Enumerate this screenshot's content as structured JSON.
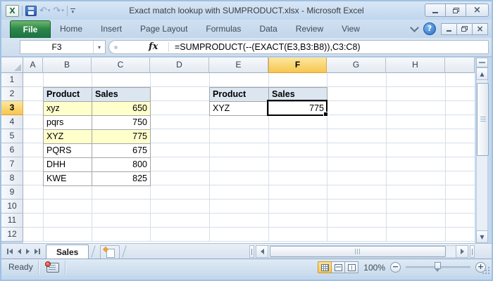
{
  "window": {
    "title": "Exact match lookup with SUMPRODUCT.xlsx - Microsoft Excel"
  },
  "ribbon": {
    "tabs": [
      "File",
      "Home",
      "Insert",
      "Page Layout",
      "Formulas",
      "Data",
      "Review",
      "View"
    ]
  },
  "formula_bar": {
    "name_box": "F3",
    "fx_label": "fx",
    "formula": "=SUMPRODUCT(--(EXACT(E3,B3:B8)),C3:C8)"
  },
  "grid": {
    "columns": [
      "A",
      "B",
      "C",
      "D",
      "E",
      "F",
      "G",
      "H"
    ],
    "rows": [
      "1",
      "2",
      "3",
      "4",
      "5",
      "6",
      "7",
      "8",
      "9",
      "10",
      "11",
      "12"
    ],
    "selected_cell": "F3",
    "selected_column": "F",
    "selected_row": "3"
  },
  "tables": {
    "left": {
      "headers": [
        "Product",
        "Sales"
      ],
      "rows": [
        [
          "xyz",
          "650"
        ],
        [
          "pqrs",
          "750"
        ],
        [
          "XYZ",
          "775"
        ],
        [
          "PQRS",
          "675"
        ],
        [
          "DHH",
          "800"
        ],
        [
          "KWE",
          "825"
        ]
      ],
      "highlighted_rows": [
        0,
        2
      ]
    },
    "right": {
      "headers": [
        "Product",
        "Sales"
      ],
      "rows": [
        [
          "XYZ",
          "775"
        ]
      ]
    }
  },
  "sheet_tabs": {
    "active": "Sales"
  },
  "status_bar": {
    "mode": "Ready",
    "zoom_level": "100%"
  },
  "icons": {
    "excel_logo": "X",
    "undo": "↶",
    "redo": "↷",
    "dropdown": "▾",
    "help": "?",
    "close": "×",
    "scroll_up": "▲",
    "scroll_down": "▼",
    "zoom_out": "−",
    "zoom_in": "+"
  },
  "colors": {
    "file_tab_green": "#1E7145",
    "selection_amber": "#F6C74E",
    "highlight_yellow": "#FFFFCC",
    "table_header_blue": "#DCE6F1",
    "titlebar_blue": "#C3D9F0"
  }
}
